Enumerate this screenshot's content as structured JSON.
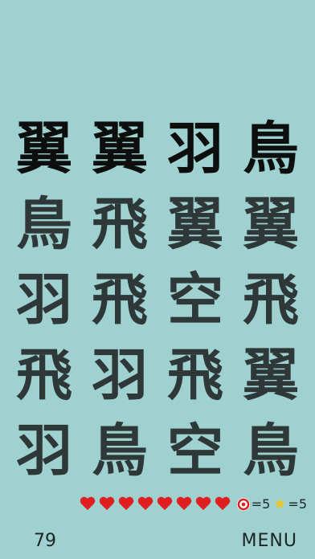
{
  "grid": {
    "rows": [
      [
        "翼",
        "翼",
        "羽",
        "鳥"
      ],
      [
        "鳥",
        "飛",
        "翼",
        "翼"
      ],
      [
        "羽",
        "飛",
        "空",
        "飛"
      ],
      [
        "飛",
        "羽",
        "飛",
        "翼"
      ],
      [
        "羽",
        "鳥",
        "空",
        "鳥"
      ]
    ]
  },
  "status": {
    "hearts": 8,
    "target_label": "=5",
    "star_label": "=5"
  },
  "footer": {
    "count": "79",
    "menu_label": "MENU"
  },
  "colors": {
    "background": "#9fd1d0",
    "tile_text": "#2f3838",
    "top_row_text": "#0d0f0f"
  }
}
